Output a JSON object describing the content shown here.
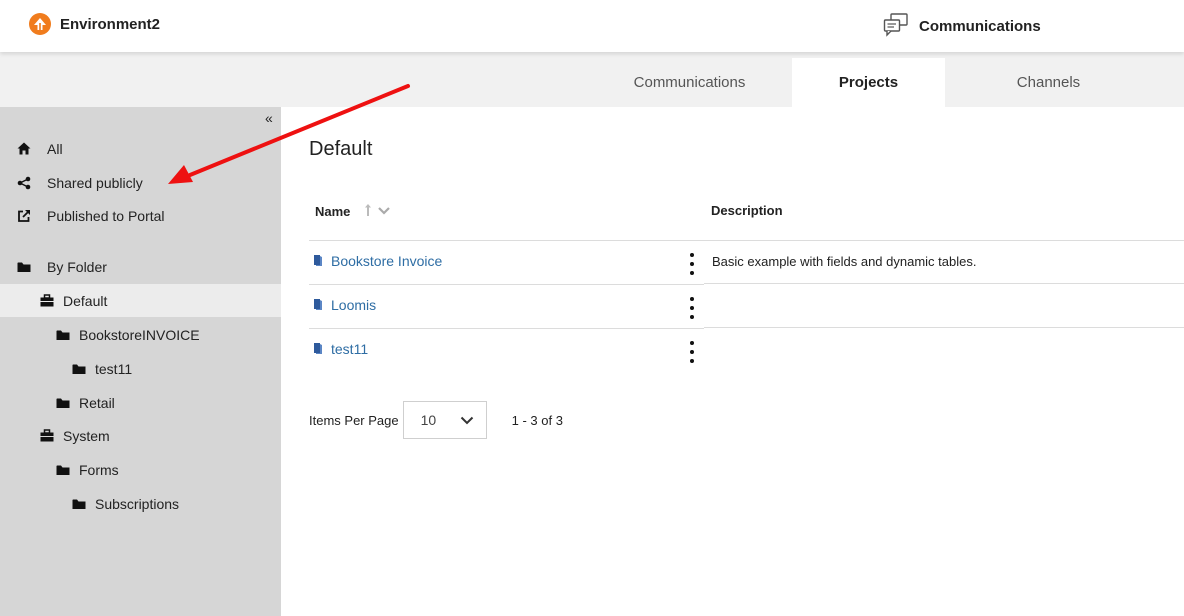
{
  "header": {
    "brand": "Environment2",
    "app_title": "Communications"
  },
  "tabs": [
    {
      "label": "Communications",
      "active": false
    },
    {
      "label": "Projects",
      "active": true
    },
    {
      "label": "Channels",
      "active": false
    }
  ],
  "sidebar": {
    "collapse_glyph": "«",
    "items": [
      {
        "label": "All",
        "icon": "home-icon"
      },
      {
        "label": "Shared publicly",
        "icon": "share-icon"
      },
      {
        "label": "Published to Portal",
        "icon": "external-link-icon"
      },
      {
        "label": "By Folder",
        "icon": "folder-icon"
      },
      {
        "label": "Default",
        "icon": "briefcase-icon",
        "active": true
      },
      {
        "label": "BookstoreINVOICE",
        "icon": "folder-icon"
      },
      {
        "label": "test11",
        "icon": "folder-icon"
      },
      {
        "label": "Retail",
        "icon": "folder-icon"
      },
      {
        "label": "System",
        "icon": "briefcase-icon"
      },
      {
        "label": "Forms",
        "icon": "folder-icon"
      },
      {
        "label": "Subscriptions",
        "icon": "folder-icon"
      }
    ]
  },
  "main": {
    "title": "Default",
    "columns": {
      "name": "Name",
      "description": "Description"
    },
    "rows": [
      {
        "name": "Bookstore Invoice",
        "description": "Basic example with fields and dynamic tables."
      },
      {
        "name": "Loomis",
        "description": ""
      },
      {
        "name": "test11",
        "description": ""
      }
    ],
    "pager": {
      "items_per_page_label": "Items Per Page",
      "page_size": "10",
      "range": "1 - 3 of 3"
    }
  },
  "colors": {
    "brand_orange": "#f07c1d",
    "link_blue": "#2e6da4",
    "annotation_red": "#ee1111"
  }
}
